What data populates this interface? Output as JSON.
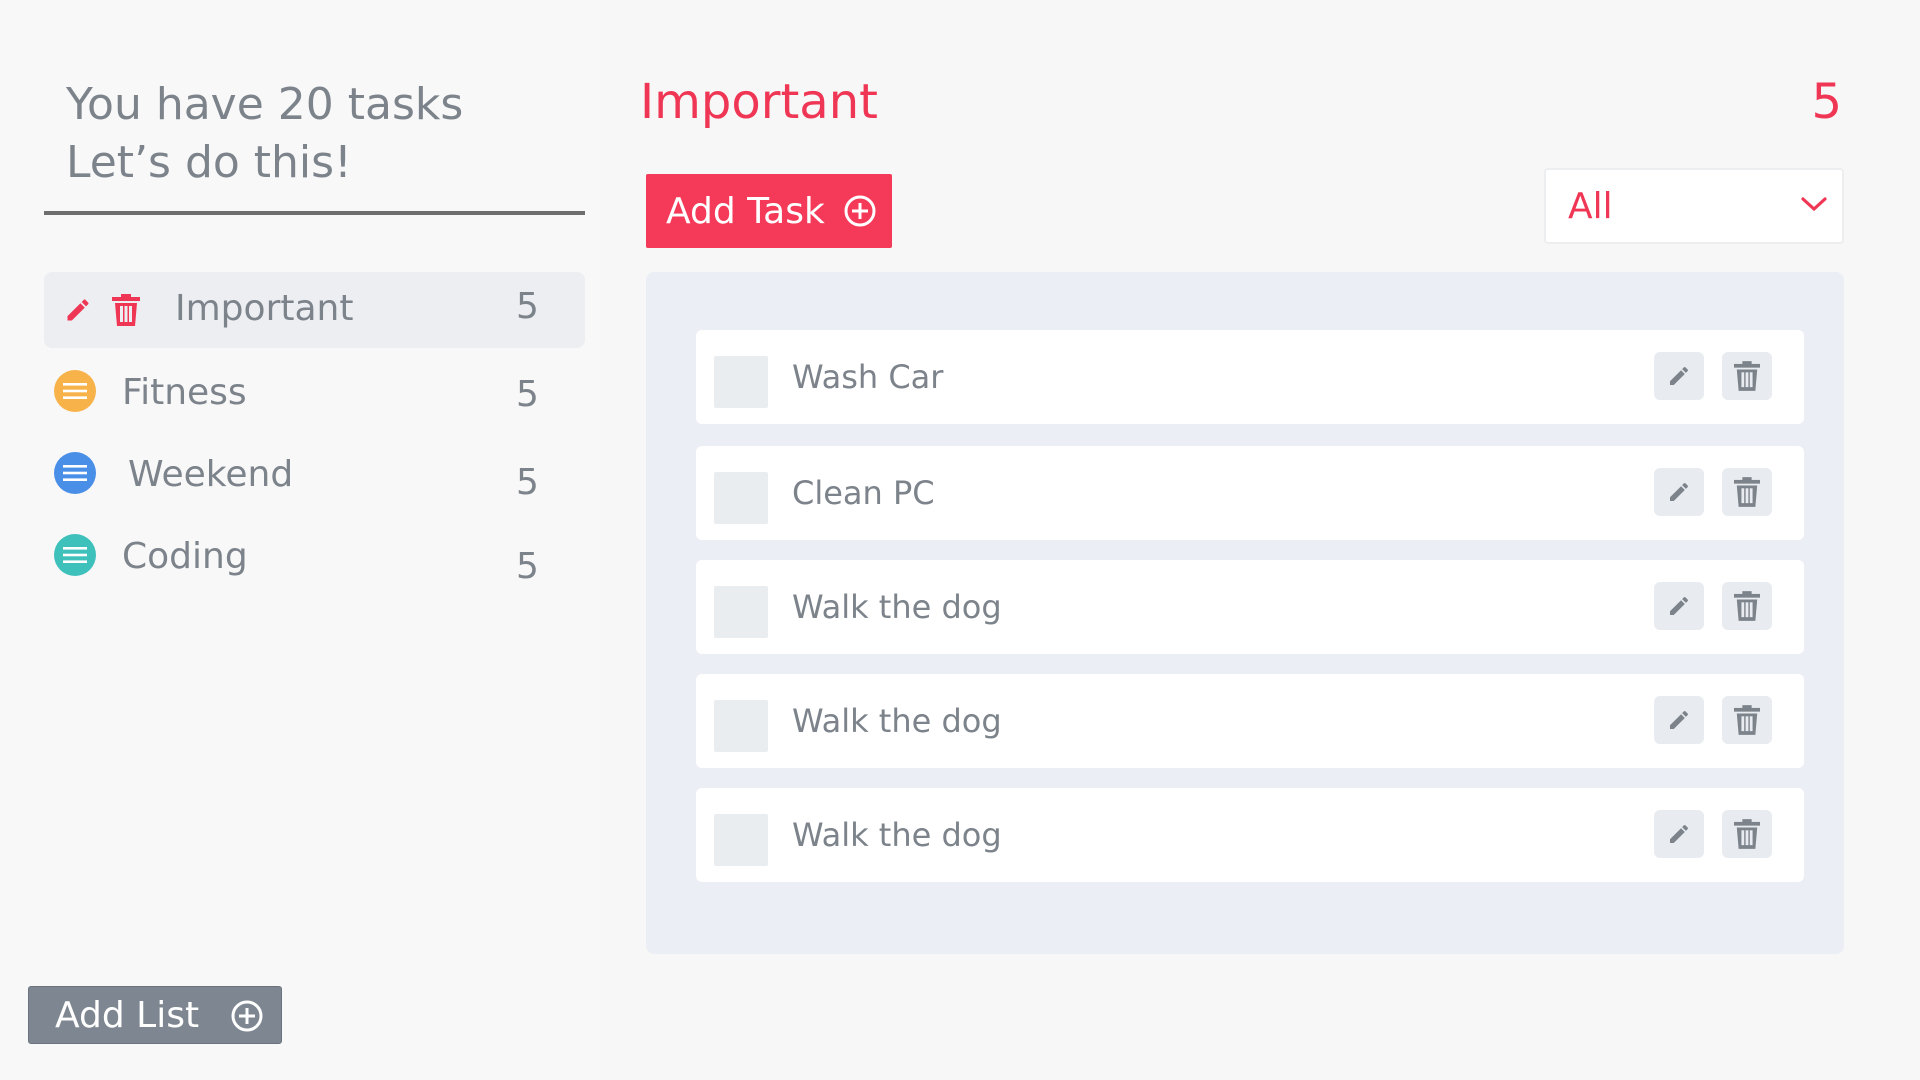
{
  "sidebar": {
    "greeting_line1": "You have 20 tasks",
    "greeting_line2": "Let’s do this!",
    "lists": [
      {
        "name": "Important",
        "count": "5",
        "icon": "pencil-icon",
        "color": "#ef3654"
      },
      {
        "name": "Fitness",
        "count": "5",
        "icon": "list-icon",
        "color": "#f7b24a"
      },
      {
        "name": "Weekend",
        "count": "5",
        "icon": "list-icon",
        "color": "#4a8fe7"
      },
      {
        "name": "Coding",
        "count": "5",
        "icon": "list-icon",
        "color": "#3ec0bb"
      }
    ],
    "add_list_label": "Add List"
  },
  "main": {
    "title": "Important",
    "count": "5",
    "add_task_label": "Add Task",
    "filter_value": "All",
    "tasks": [
      {
        "name": "Wash Car"
      },
      {
        "name": "Clean PC"
      },
      {
        "name": "Walk the dog"
      },
      {
        "name": "Walk the dog"
      },
      {
        "name": "Walk the dog"
      }
    ]
  },
  "colors": {
    "accent": "#ef3654",
    "text_muted": "#7c838b",
    "panel_bg": "#ebeef4"
  }
}
